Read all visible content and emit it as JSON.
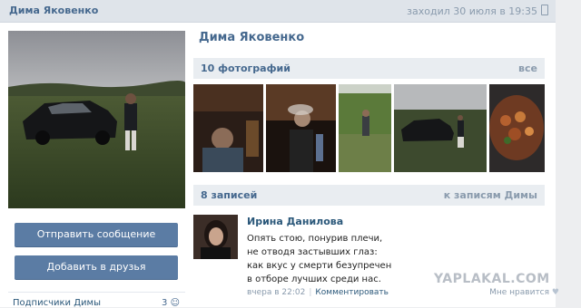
{
  "header": {
    "profile_name": "Дима Яковенко",
    "last_seen": "заходил 30 июля в 19:35"
  },
  "profile": {
    "name": "Дима Яковенко",
    "buttons": {
      "message": "Отправить сообщение",
      "add_friend": "Добавить в друзья"
    },
    "subscribers": {
      "label": "Подписчики Димы",
      "count": "3"
    }
  },
  "photos": {
    "title": "10 фотографий",
    "all_link": "все"
  },
  "wall": {
    "title": "8 записей",
    "to_wall_link": "к записям Димы",
    "post": {
      "author": "Ирина Данилова",
      "lines": [
        "Опять стою, понурив плечи,",
        "не отводя застывших глаз:",
        "как вкус у смерти безупречен",
        "в отборе лучших среди нас."
      ],
      "time": "вчера в 22:02",
      "action": "Комментировать",
      "likes": "Мне нравится"
    }
  },
  "watermark": "YAPLAKAL.COM",
  "colors": {
    "accent": "#45688e",
    "button": "#5b7ca4",
    "section_header": "#e9edf1"
  }
}
